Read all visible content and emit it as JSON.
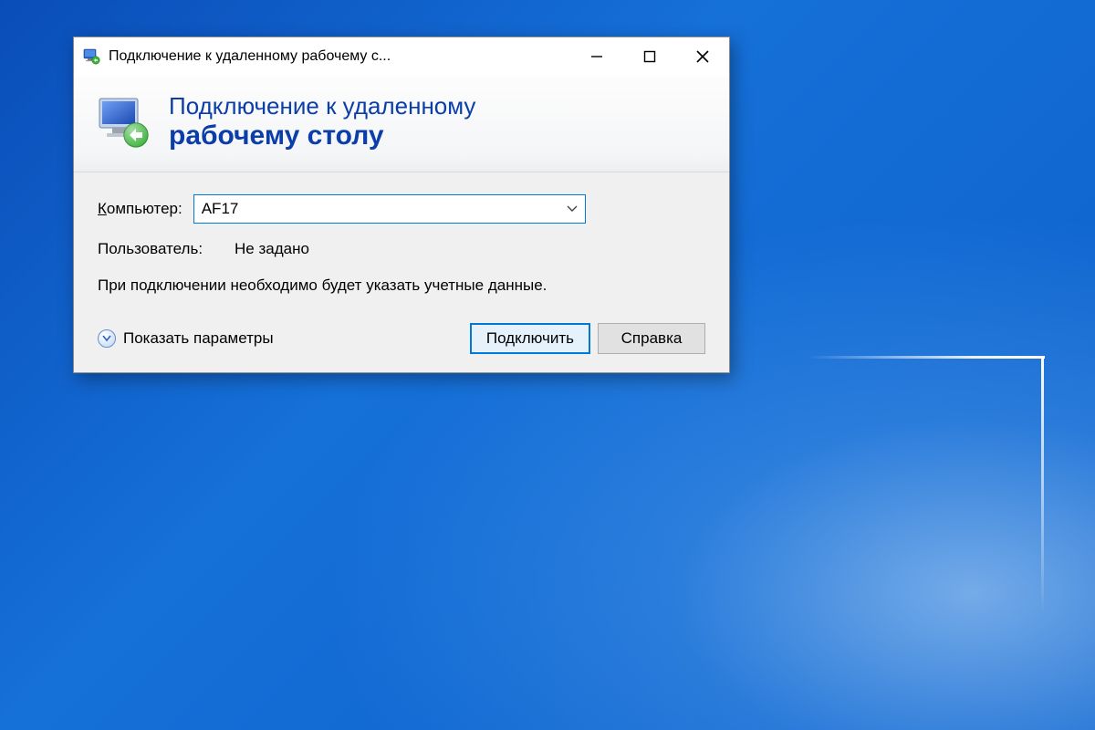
{
  "window": {
    "title": "Подключение к удаленному рабочему с..."
  },
  "header": {
    "line1": "Подключение к удаленному",
    "line2": "рабочему столу"
  },
  "form": {
    "computer_label_prefix": "К",
    "computer_label_rest": "омпьютер:",
    "computer_value": "AF17",
    "user_label": "Пользователь:",
    "user_value": "Не задано",
    "info": "При подключении необходимо будет указать учетные данные."
  },
  "footer": {
    "show_options_prefix": "П",
    "show_options_rest": "оказать параметры",
    "connect_prefix": "П",
    "connect_rest": "одключить",
    "help_prefix": "С",
    "help_rest": "правка"
  }
}
